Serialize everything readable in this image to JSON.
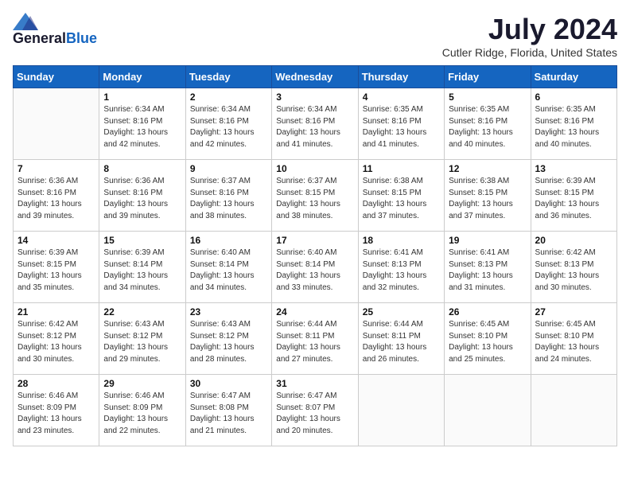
{
  "header": {
    "logo_general": "General",
    "logo_blue": "Blue",
    "month_year": "July 2024",
    "location": "Cutler Ridge, Florida, United States"
  },
  "days_of_week": [
    "Sunday",
    "Monday",
    "Tuesday",
    "Wednesday",
    "Thursday",
    "Friday",
    "Saturday"
  ],
  "weeks": [
    [
      {
        "day": "",
        "sunrise": "",
        "sunset": "",
        "daylight": ""
      },
      {
        "day": "1",
        "sunrise": "Sunrise: 6:34 AM",
        "sunset": "Sunset: 8:16 PM",
        "daylight": "Daylight: 13 hours and 42 minutes."
      },
      {
        "day": "2",
        "sunrise": "Sunrise: 6:34 AM",
        "sunset": "Sunset: 8:16 PM",
        "daylight": "Daylight: 13 hours and 42 minutes."
      },
      {
        "day": "3",
        "sunrise": "Sunrise: 6:34 AM",
        "sunset": "Sunset: 8:16 PM",
        "daylight": "Daylight: 13 hours and 41 minutes."
      },
      {
        "day": "4",
        "sunrise": "Sunrise: 6:35 AM",
        "sunset": "Sunset: 8:16 PM",
        "daylight": "Daylight: 13 hours and 41 minutes."
      },
      {
        "day": "5",
        "sunrise": "Sunrise: 6:35 AM",
        "sunset": "Sunset: 8:16 PM",
        "daylight": "Daylight: 13 hours and 40 minutes."
      },
      {
        "day": "6",
        "sunrise": "Sunrise: 6:35 AM",
        "sunset": "Sunset: 8:16 PM",
        "daylight": "Daylight: 13 hours and 40 minutes."
      }
    ],
    [
      {
        "day": "7",
        "sunrise": "Sunrise: 6:36 AM",
        "sunset": "Sunset: 8:16 PM",
        "daylight": "Daylight: 13 hours and 39 minutes."
      },
      {
        "day": "8",
        "sunrise": "Sunrise: 6:36 AM",
        "sunset": "Sunset: 8:16 PM",
        "daylight": "Daylight: 13 hours and 39 minutes."
      },
      {
        "day": "9",
        "sunrise": "Sunrise: 6:37 AM",
        "sunset": "Sunset: 8:16 PM",
        "daylight": "Daylight: 13 hours and 38 minutes."
      },
      {
        "day": "10",
        "sunrise": "Sunrise: 6:37 AM",
        "sunset": "Sunset: 8:15 PM",
        "daylight": "Daylight: 13 hours and 38 minutes."
      },
      {
        "day": "11",
        "sunrise": "Sunrise: 6:38 AM",
        "sunset": "Sunset: 8:15 PM",
        "daylight": "Daylight: 13 hours and 37 minutes."
      },
      {
        "day": "12",
        "sunrise": "Sunrise: 6:38 AM",
        "sunset": "Sunset: 8:15 PM",
        "daylight": "Daylight: 13 hours and 37 minutes."
      },
      {
        "day": "13",
        "sunrise": "Sunrise: 6:39 AM",
        "sunset": "Sunset: 8:15 PM",
        "daylight": "Daylight: 13 hours and 36 minutes."
      }
    ],
    [
      {
        "day": "14",
        "sunrise": "Sunrise: 6:39 AM",
        "sunset": "Sunset: 8:15 PM",
        "daylight": "Daylight: 13 hours and 35 minutes."
      },
      {
        "day": "15",
        "sunrise": "Sunrise: 6:39 AM",
        "sunset": "Sunset: 8:14 PM",
        "daylight": "Daylight: 13 hours and 34 minutes."
      },
      {
        "day": "16",
        "sunrise": "Sunrise: 6:40 AM",
        "sunset": "Sunset: 8:14 PM",
        "daylight": "Daylight: 13 hours and 34 minutes."
      },
      {
        "day": "17",
        "sunrise": "Sunrise: 6:40 AM",
        "sunset": "Sunset: 8:14 PM",
        "daylight": "Daylight: 13 hours and 33 minutes."
      },
      {
        "day": "18",
        "sunrise": "Sunrise: 6:41 AM",
        "sunset": "Sunset: 8:13 PM",
        "daylight": "Daylight: 13 hours and 32 minutes."
      },
      {
        "day": "19",
        "sunrise": "Sunrise: 6:41 AM",
        "sunset": "Sunset: 8:13 PM",
        "daylight": "Daylight: 13 hours and 31 minutes."
      },
      {
        "day": "20",
        "sunrise": "Sunrise: 6:42 AM",
        "sunset": "Sunset: 8:13 PM",
        "daylight": "Daylight: 13 hours and 30 minutes."
      }
    ],
    [
      {
        "day": "21",
        "sunrise": "Sunrise: 6:42 AM",
        "sunset": "Sunset: 8:12 PM",
        "daylight": "Daylight: 13 hours and 30 minutes."
      },
      {
        "day": "22",
        "sunrise": "Sunrise: 6:43 AM",
        "sunset": "Sunset: 8:12 PM",
        "daylight": "Daylight: 13 hours and 29 minutes."
      },
      {
        "day": "23",
        "sunrise": "Sunrise: 6:43 AM",
        "sunset": "Sunset: 8:12 PM",
        "daylight": "Daylight: 13 hours and 28 minutes."
      },
      {
        "day": "24",
        "sunrise": "Sunrise: 6:44 AM",
        "sunset": "Sunset: 8:11 PM",
        "daylight": "Daylight: 13 hours and 27 minutes."
      },
      {
        "day": "25",
        "sunrise": "Sunrise: 6:44 AM",
        "sunset": "Sunset: 8:11 PM",
        "daylight": "Daylight: 13 hours and 26 minutes."
      },
      {
        "day": "26",
        "sunrise": "Sunrise: 6:45 AM",
        "sunset": "Sunset: 8:10 PM",
        "daylight": "Daylight: 13 hours and 25 minutes."
      },
      {
        "day": "27",
        "sunrise": "Sunrise: 6:45 AM",
        "sunset": "Sunset: 8:10 PM",
        "daylight": "Daylight: 13 hours and 24 minutes."
      }
    ],
    [
      {
        "day": "28",
        "sunrise": "Sunrise: 6:46 AM",
        "sunset": "Sunset: 8:09 PM",
        "daylight": "Daylight: 13 hours and 23 minutes."
      },
      {
        "day": "29",
        "sunrise": "Sunrise: 6:46 AM",
        "sunset": "Sunset: 8:09 PM",
        "daylight": "Daylight: 13 hours and 22 minutes."
      },
      {
        "day": "30",
        "sunrise": "Sunrise: 6:47 AM",
        "sunset": "Sunset: 8:08 PM",
        "daylight": "Daylight: 13 hours and 21 minutes."
      },
      {
        "day": "31",
        "sunrise": "Sunrise: 6:47 AM",
        "sunset": "Sunset: 8:07 PM",
        "daylight": "Daylight: 13 hours and 20 minutes."
      },
      {
        "day": "",
        "sunrise": "",
        "sunset": "",
        "daylight": ""
      },
      {
        "day": "",
        "sunrise": "",
        "sunset": "",
        "daylight": ""
      },
      {
        "day": "",
        "sunrise": "",
        "sunset": "",
        "daylight": ""
      }
    ]
  ]
}
